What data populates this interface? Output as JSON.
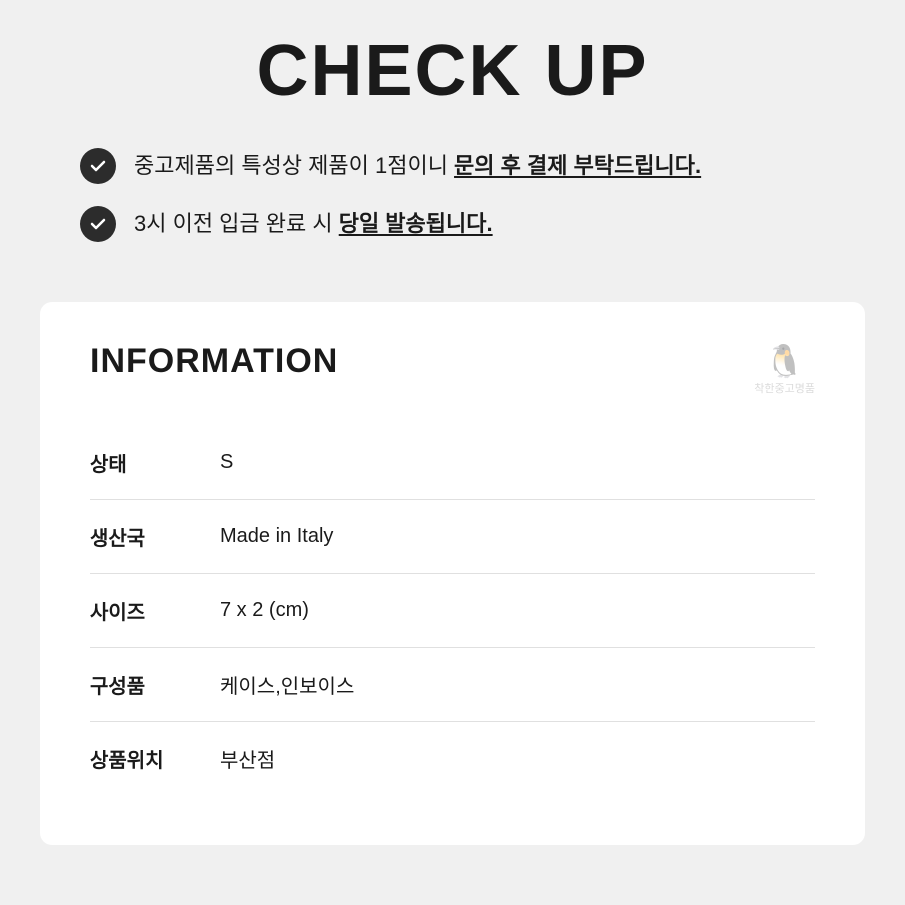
{
  "checkup": {
    "title": "CHECK UP",
    "items": [
      {
        "text_plain": "중고제품의 특성상 제품이 1점이니 ",
        "text_bold": "문의 후 결제 부탁드립니다."
      },
      {
        "text_plain": "3시 이전 입금 완료 시 ",
        "text_bold": "당일 발송됩니다."
      }
    ]
  },
  "information": {
    "section_title": "INFORMATION",
    "watermark_line1": "착한중고명품",
    "rows": [
      {
        "label": "상태",
        "value": "S"
      },
      {
        "label": "생산국",
        "value": "Made in Italy"
      },
      {
        "label": "사이즈",
        "value": "7 x 2 (cm)"
      },
      {
        "label": "구성품",
        "value": "케이스,인보이스"
      },
      {
        "label": "상품위치",
        "value": "부산점"
      }
    ]
  }
}
